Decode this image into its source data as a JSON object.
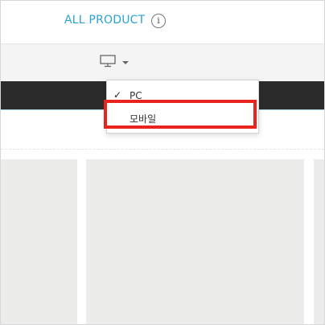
{
  "header": {
    "title": "ALL PRODUCT",
    "info_icon": "i"
  },
  "toolbar": {
    "device_icon": "monitor-icon",
    "dropdown_caret": "chevron-down-icon"
  },
  "device_menu": {
    "options": [
      {
        "label": "PC",
        "selected": true
      },
      {
        "label": "모바일",
        "selected": false
      }
    ],
    "check_mark": "✓"
  },
  "colors": {
    "title_blue": "#2aa3d3",
    "nav_dark": "#2b2b2b",
    "highlight_red": "#e8241c"
  }
}
